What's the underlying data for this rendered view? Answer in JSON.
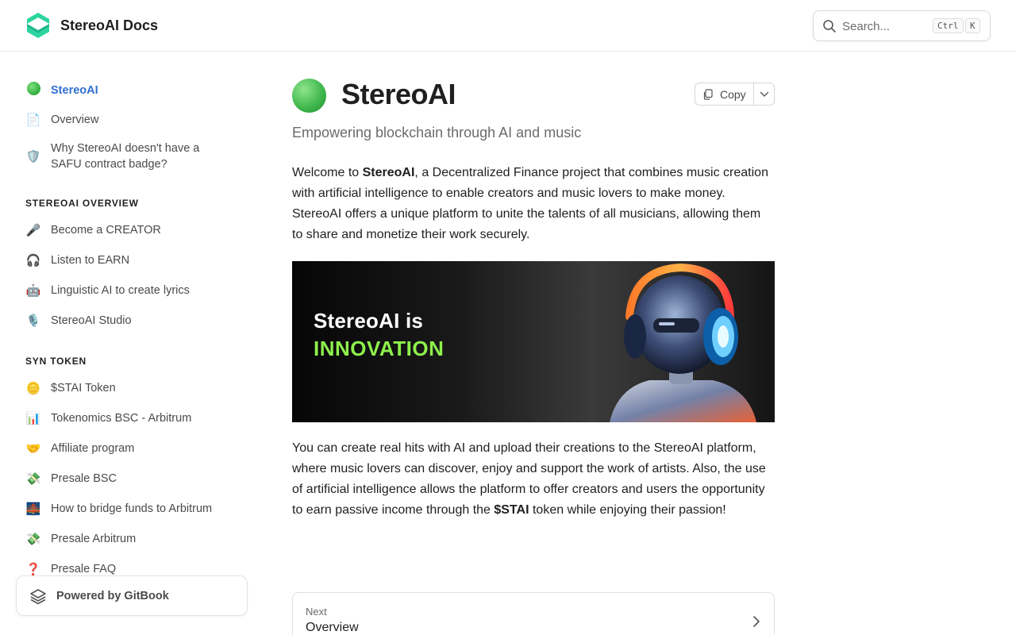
{
  "header": {
    "site_title": "StereoAI Docs",
    "search": {
      "placeholder": "Search...",
      "shortcut_ctrl": "Ctrl",
      "shortcut_key": "K"
    }
  },
  "sidebar": {
    "top_items": [
      {
        "emoji": "green-circle",
        "label": "StereoAI",
        "active": true
      },
      {
        "emoji": "📄",
        "label": "Overview"
      },
      {
        "emoji": "🛡️",
        "label": "Why StereoAI doesn't have a SAFU contract badge?"
      }
    ],
    "sections": [
      {
        "title": "STEREOAI OVERVIEW",
        "items": [
          {
            "emoji": "🎤",
            "label": "Become a CREATOR"
          },
          {
            "emoji": "🎧",
            "label": "Listen to EARN"
          },
          {
            "emoji": "🤖",
            "label": "Linguistic AI to create lyrics"
          },
          {
            "emoji": "🎙️",
            "label": "StereoAI Studio"
          }
        ]
      },
      {
        "title": "SYN TOKEN",
        "items": [
          {
            "emoji": "🪙",
            "label": "$STAI Token"
          },
          {
            "emoji": "📊",
            "label": "Tokenomics BSC - Arbitrum"
          },
          {
            "emoji": "🤝",
            "label": "Affiliate program"
          },
          {
            "emoji": "💸",
            "label": "Presale BSC"
          },
          {
            "emoji": "🌉",
            "label": "How to bridge funds to Arbitrum"
          },
          {
            "emoji": "💸",
            "label": "Presale Arbitrum"
          },
          {
            "emoji": "❓",
            "label": "Presale FAQ"
          }
        ]
      }
    ],
    "powered_by": "Powered by GitBook"
  },
  "page": {
    "title": "StereoAI",
    "copy_label": "Copy",
    "subtitle": "Empowering blockchain through AI and music",
    "p1": {
      "pre": "Welcome to ",
      "bold": "StereoAI",
      "post": ", a Decentralized Finance project that combines music creation with artificial intelligence to enable creators and music lovers to make money. StereoAI offers a unique platform to unite the talents of all musicians, allowing them to share and monetize their work securely."
    },
    "banner": {
      "line1": "StereoAI is",
      "line2": "INNOVATION"
    },
    "p2": {
      "pre": "You can create real hits with AI and upload their creations to the StereoAI platform, where music lovers can discover, enjoy and support the work of artists. Also, the use of artificial intelligence allows the platform to offer creators and users the opportunity to earn passive income through the ",
      "bold": "$STAI",
      "post": " token while enjoying their passion!"
    },
    "next": {
      "caption": "Next",
      "title": "Overview"
    }
  },
  "colors": {
    "accent": "#2f6fd0",
    "banner_highlight": "#8ef04c",
    "logo": "#2bd5a0"
  }
}
